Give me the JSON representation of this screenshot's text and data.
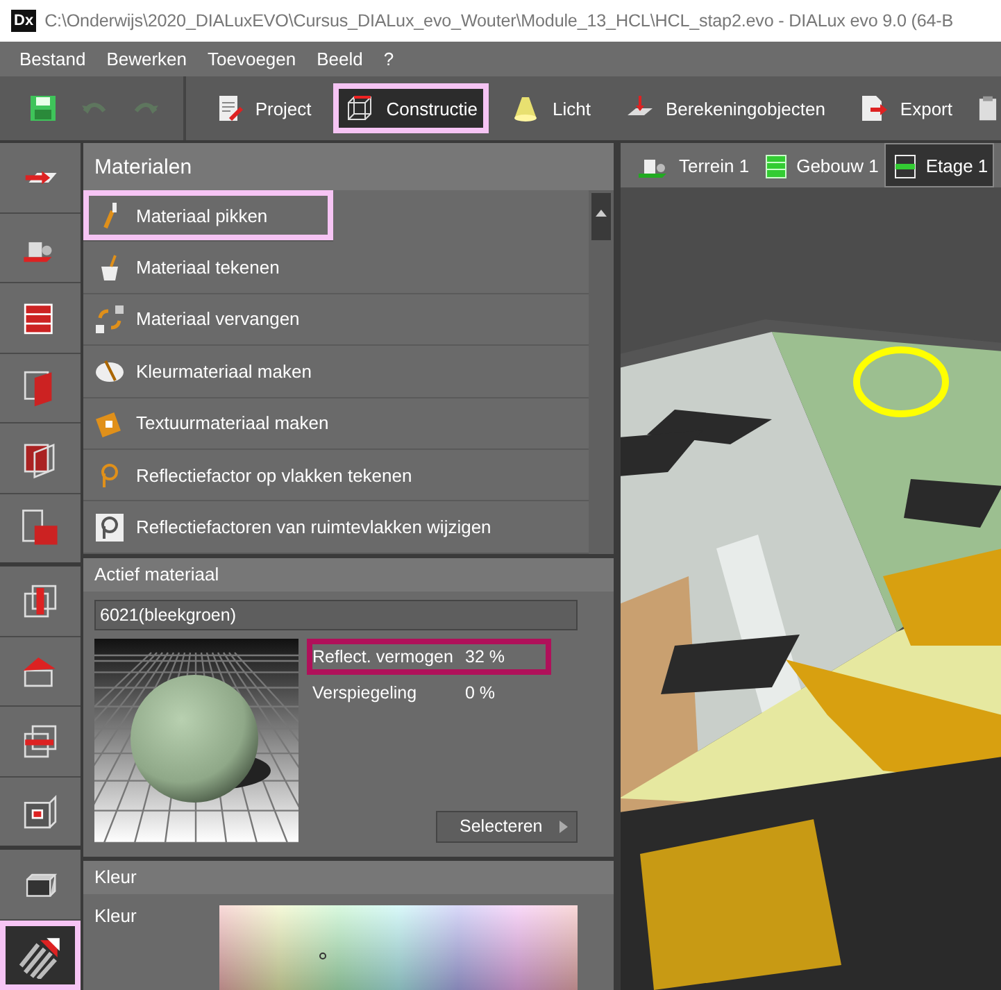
{
  "title_bar": {
    "app_icon": "Dx",
    "title": "C:\\Onderwijs\\2020_DIALuxEVO\\Cursus_DIALux_evo_Wouter\\Module_13_HCL\\HCL_stap2.evo - DIALux evo 9.0  (64-B"
  },
  "menu": [
    "Bestand",
    "Bewerken",
    "Toevoegen",
    "Beeld",
    "?"
  ],
  "quick_actions": [
    {
      "kind": "save",
      "disabled": false
    },
    {
      "kind": "undo",
      "disabled": true
    },
    {
      "kind": "redo",
      "disabled": true
    }
  ],
  "modes": [
    {
      "label": "Project",
      "selected": false,
      "highlighted": false
    },
    {
      "label": "Constructie",
      "selected": true,
      "highlighted": true
    },
    {
      "label": "Licht",
      "selected": false,
      "highlighted": false
    },
    {
      "label": "Berekeningobjecten",
      "selected": false,
      "highlighted": false
    },
    {
      "label": "Export",
      "selected": false,
      "highlighted": false
    }
  ],
  "tool_groups": [
    [
      {
        "selected": false,
        "highlighted": false
      },
      {
        "selected": false,
        "highlighted": false
      },
      {
        "selected": false,
        "highlighted": false
      },
      {
        "selected": false,
        "highlighted": false
      },
      {
        "selected": false,
        "highlighted": false
      },
      {
        "selected": false,
        "highlighted": false
      }
    ],
    [
      {
        "selected": false,
        "highlighted": false
      },
      {
        "selected": false,
        "highlighted": false
      },
      {
        "selected": false,
        "highlighted": false
      },
      {
        "selected": false,
        "highlighted": false
      }
    ],
    [
      {
        "selected": false,
        "highlighted": false
      },
      {
        "selected": true,
        "highlighted": true
      }
    ]
  ],
  "materials": {
    "title": "Materialen",
    "items": [
      {
        "label": "Materiaal pikken",
        "highlighted": true
      },
      {
        "label": "Materiaal tekenen",
        "highlighted": false
      },
      {
        "label": "Materiaal vervangen",
        "highlighted": false
      },
      {
        "label": "Kleurmateriaal maken",
        "highlighted": false
      },
      {
        "label": "Textuurmateriaal maken",
        "highlighted": false
      },
      {
        "label": "Reflectiefactor op vlakken tekenen",
        "highlighted": false
      },
      {
        "label": "Reflectiefactoren van ruimtevlakken wijzigen",
        "highlighted": false
      }
    ]
  },
  "active_material": {
    "title": "Actief materiaal",
    "name": "6021(bleekgroen)",
    "properties": [
      {
        "label": "Reflect. vermogen",
        "value": "32 %",
        "highlighted": true
      },
      {
        "label": "Verspiegeling",
        "value": "0 %",
        "highlighted": false
      }
    ],
    "button": "Selecteren"
  },
  "color": {
    "title": "Kleur",
    "label": "Kleur"
  },
  "view_tabs": [
    {
      "label": "Terrein 1",
      "selected": false
    },
    {
      "label": "Gebouw 1",
      "selected": false
    },
    {
      "label": "Etage 1",
      "selected": true
    }
  ]
}
